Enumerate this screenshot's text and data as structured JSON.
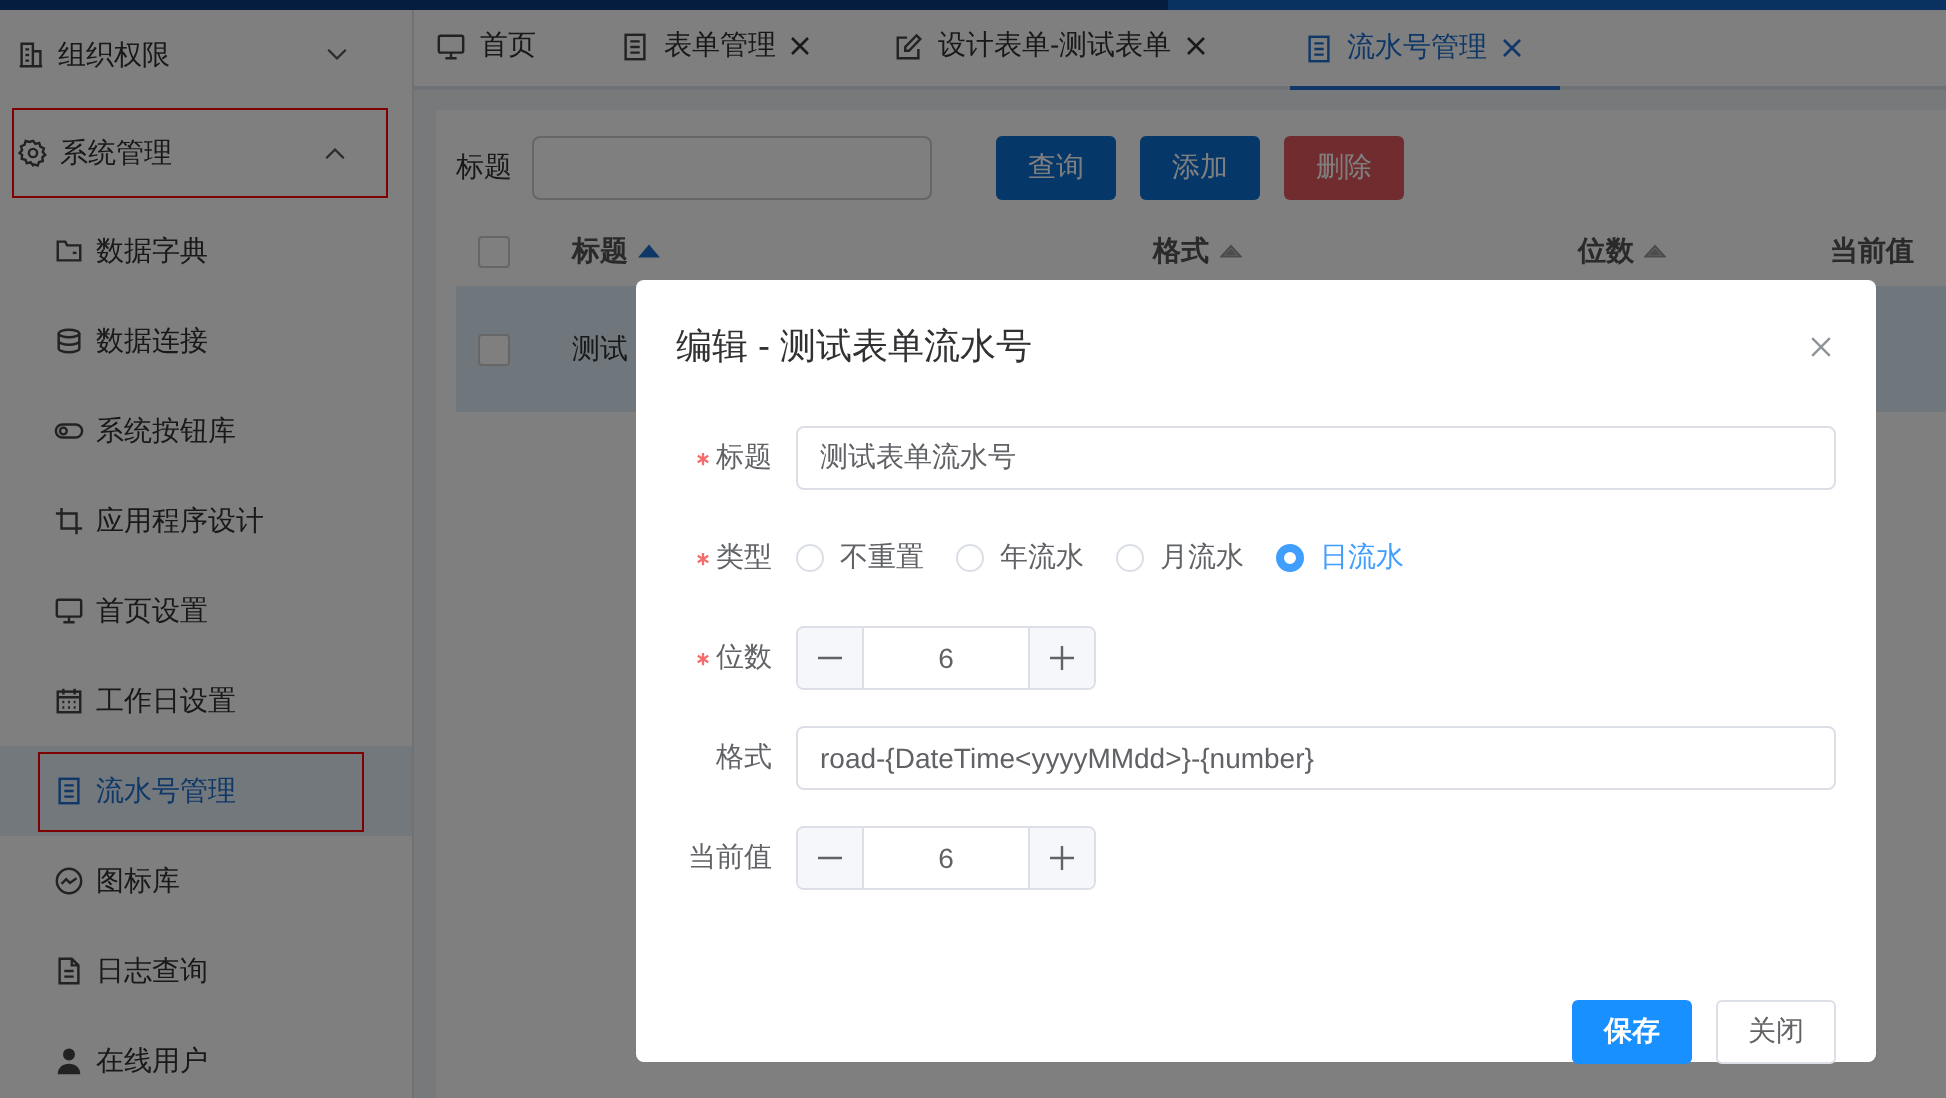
{
  "sidebar": {
    "groups": [
      {
        "label": "组织权限",
        "expanded": false,
        "annotated": false
      },
      {
        "label": "系统管理",
        "expanded": true,
        "annotated": true,
        "children": [
          {
            "label": "数据字典",
            "selected": false,
            "annotated": false
          },
          {
            "label": "数据连接",
            "selected": false,
            "annotated": false
          },
          {
            "label": "系统按钮库",
            "selected": false,
            "annotated": false
          },
          {
            "label": "应用程序设计",
            "selected": false,
            "annotated": false
          },
          {
            "label": "首页设置",
            "selected": false,
            "annotated": false
          },
          {
            "label": "工作日设置",
            "selected": false,
            "annotated": false
          },
          {
            "label": "流水号管理",
            "selected": true,
            "annotated": true
          },
          {
            "label": "图标库",
            "selected": false,
            "annotated": false
          },
          {
            "label": "日志查询",
            "selected": false,
            "annotated": false
          },
          {
            "label": "在线用户",
            "selected": false,
            "annotated": false
          }
        ]
      }
    ]
  },
  "tabs": [
    {
      "label": "首页",
      "closable": false,
      "selected": false
    },
    {
      "label": "表单管理",
      "closable": true,
      "selected": false
    },
    {
      "label": "设计表单-测试表单",
      "closable": true,
      "selected": false
    },
    {
      "label": "流水号管理",
      "closable": true,
      "selected": true
    }
  ],
  "search": {
    "label": "标题",
    "buttons": [
      {
        "label": "查询",
        "kind": "primary"
      },
      {
        "label": "添加",
        "kind": "primary"
      },
      {
        "label": "删除",
        "kind": "danger"
      }
    ]
  },
  "table": {
    "header_checked": false,
    "columns": [
      {
        "label": "标题",
        "kind": "sortable",
        "sorted": true
      },
      {
        "label": "格式",
        "kind": "sortable",
        "sorted": false
      },
      {
        "label": "位数",
        "kind": "sortable",
        "sorted": false
      },
      {
        "label": "当前值",
        "kind": "plain"
      }
    ],
    "rows": [
      {
        "checked": false,
        "selected": true,
        "cells": [
          "测试"
        ]
      }
    ]
  },
  "dialog": {
    "title": "编辑 - 测试表单流水号",
    "fields": [
      {
        "kind": "text",
        "label": "标题",
        "required": true,
        "value": "测试表单流水号"
      },
      {
        "kind": "radio",
        "label": "类型",
        "required": true,
        "options": [
          {
            "label": "不重置",
            "selected": false
          },
          {
            "label": "年流水",
            "selected": false
          },
          {
            "label": "月流水",
            "selected": false
          },
          {
            "label": "日流水",
            "selected": true
          }
        ]
      },
      {
        "kind": "number",
        "label": "位数",
        "required": true,
        "value": "6"
      },
      {
        "kind": "text",
        "label": "格式",
        "required": false,
        "value": "road-{DateTime<yyyyMMdd>}-{number}"
      },
      {
        "kind": "number",
        "label": "当前值",
        "required": false,
        "value": "6"
      }
    ],
    "buttons": [
      {
        "label": "保存",
        "kind": "primary"
      },
      {
        "label": "关闭",
        "kind": "default"
      }
    ]
  }
}
